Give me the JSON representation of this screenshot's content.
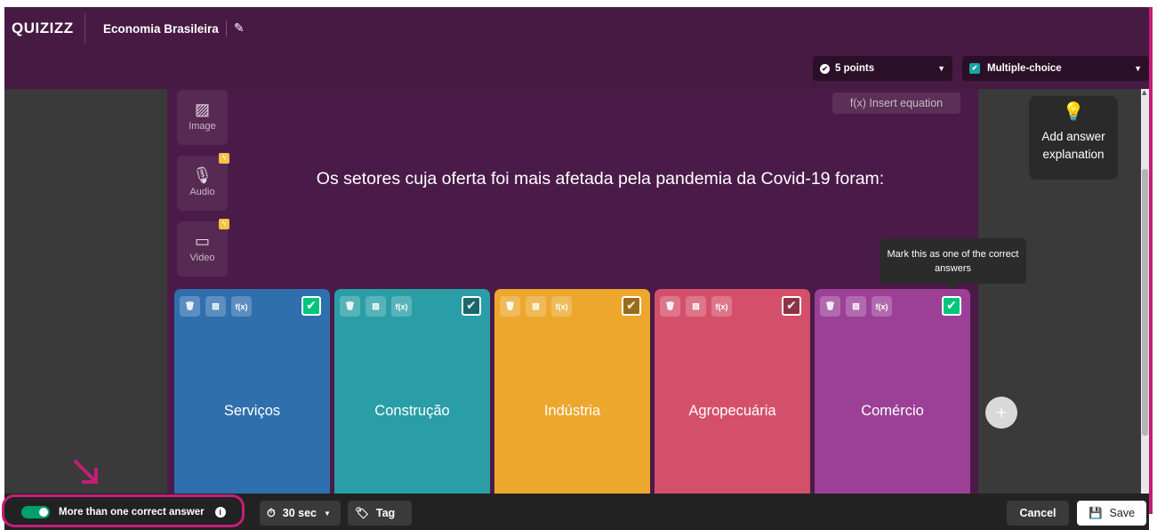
{
  "header": {
    "logo": "QUIZIZZ",
    "quiz_title": "Economia Brasileira",
    "edit_icon": "pencil-icon"
  },
  "settings": {
    "points": "5 points",
    "question_type": "Multiple-choice"
  },
  "media": [
    {
      "label": "Image",
      "icon": "image-icon"
    },
    {
      "label": "Audio",
      "icon": "microphone-icon",
      "badge": "lightning-icon"
    },
    {
      "label": "Video",
      "icon": "video-icon",
      "badge": "lightning-icon"
    }
  ],
  "insert_equation": "f(x) Insert equation",
  "question": "Os setores cuja oferta foi mais afetada pela pandemia da Covid-19 foram:",
  "tooltip": "Mark this as one of the correct answers",
  "explanation": "Add answer explanation",
  "answers": [
    {
      "text": "Serviços",
      "color": "#2f6fad",
      "correct": true
    },
    {
      "text": "Construção",
      "color": "#2a9ea6",
      "correct": false
    },
    {
      "text": "Indústria",
      "color": "#eca72c",
      "correct": false
    },
    {
      "text": "Agropecuária",
      "color": "#d4506a",
      "correct": false
    },
    {
      "text": "Comércio",
      "color": "#9b4096",
      "correct": true
    }
  ],
  "answer_tools": [
    "trash-icon",
    "image-icon",
    "f(x)"
  ],
  "add_option": "+",
  "bottom": {
    "multi_correct_label": "More than one correct answer",
    "multi_correct_on": true,
    "timer": "30 sec",
    "tag": "Tag",
    "cancel": "Cancel",
    "save": "Save"
  },
  "colors": {
    "brand_purple": "#461a42",
    "highlight": "#c41e78",
    "toggle_green": "#00a06a"
  }
}
